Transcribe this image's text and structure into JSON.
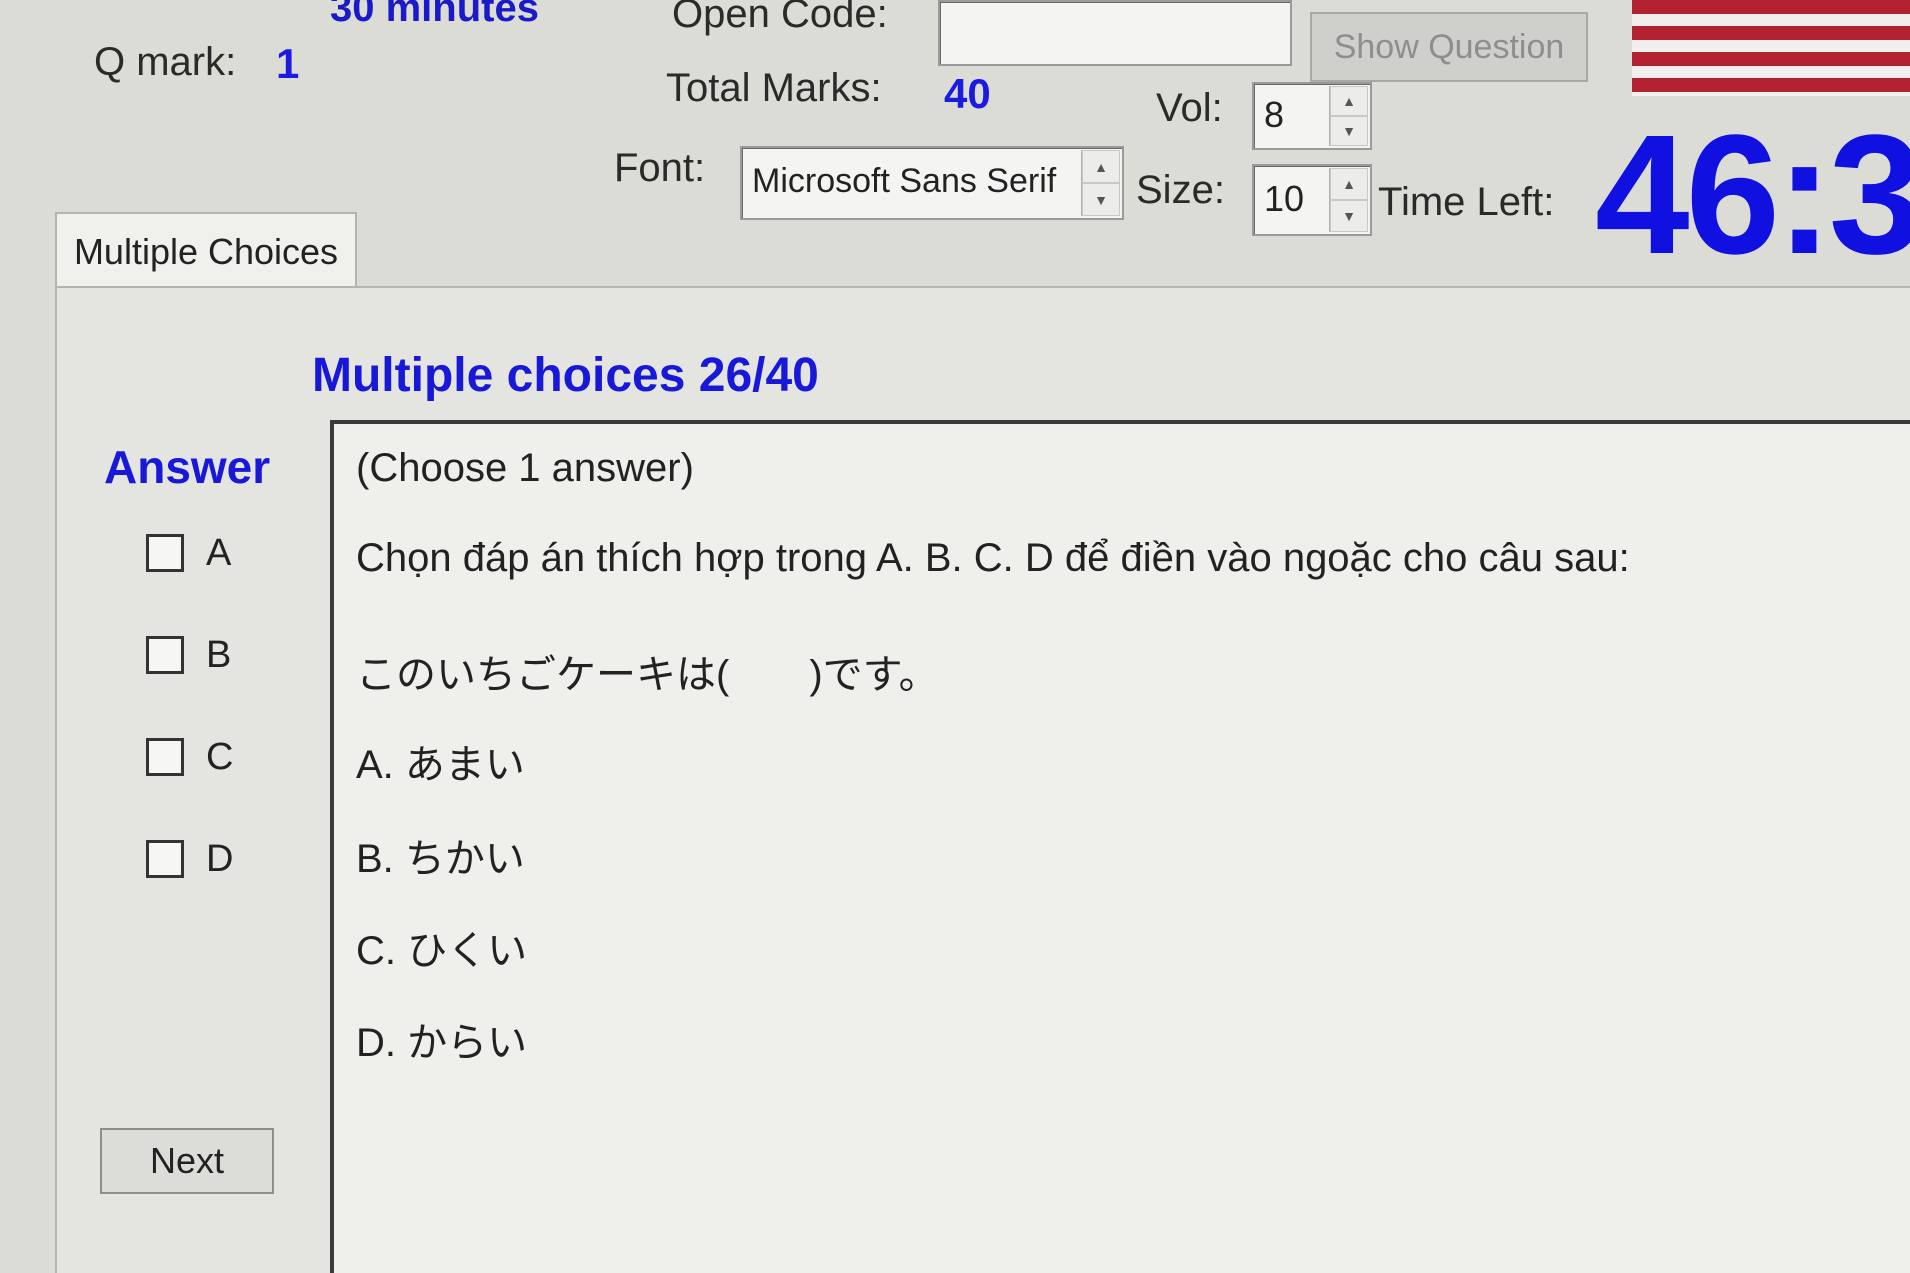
{
  "header": {
    "partial_heading": "30 minutes",
    "q_mark_label": "Q mark:",
    "q_mark_value": "1",
    "open_code_label": "Open Code:",
    "open_code_value": "",
    "show_question_label": "Show Question",
    "total_marks_label": "Total Marks:",
    "total_marks_value": "40",
    "vol_label": "Vol:",
    "vol_value": "8",
    "font_label": "Font:",
    "font_value": "Microsoft Sans Serif",
    "size_label": "Size:",
    "size_value": "10",
    "time_left_label": "Time Left:",
    "time_left_value": "46:3"
  },
  "tabs": [
    {
      "label": "Multiple Choices",
      "active": true
    }
  ],
  "main": {
    "section_title": "Multiple choices 26/40",
    "answer_title": "Answer",
    "answer_options": [
      {
        "letter": "A",
        "checked": false
      },
      {
        "letter": "B",
        "checked": false
      },
      {
        "letter": "C",
        "checked": false
      },
      {
        "letter": "D",
        "checked": false
      }
    ],
    "next_label": "Next"
  },
  "question": {
    "instruction": "(Choose 1 answer)",
    "prompt": "Chọn đáp án thích hợp trong A. B. C. D để điền vào ngoặc cho câu sau:",
    "sentence": "このいちごケーキは(　　)です。",
    "choices": [
      "A. あまい",
      "B. ちかい",
      "C. ひくい",
      "D. からい"
    ]
  },
  "colors": {
    "accent_blue": "#1818d8",
    "timer_blue": "#1010e0",
    "background": "#dcdcd6",
    "flag_red": "#b22230"
  }
}
